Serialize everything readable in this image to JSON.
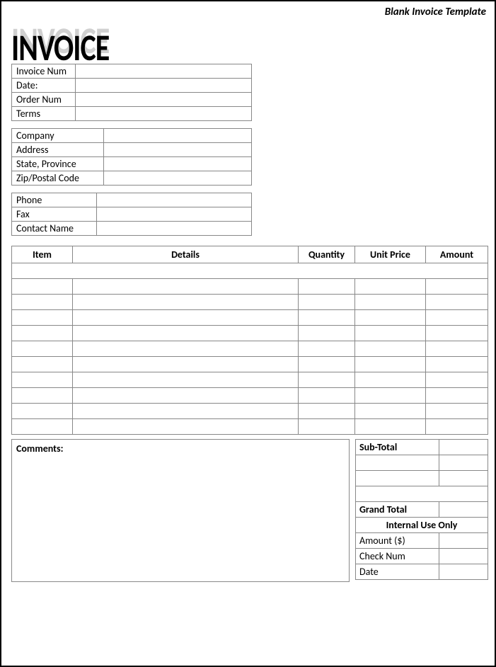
{
  "header": {
    "template_label": "Blank Invoice Template",
    "title": "INVOICE"
  },
  "info": {
    "rows": [
      {
        "label": "Invoice Num",
        "value": ""
      },
      {
        "label": "Date:",
        "value": ""
      },
      {
        "label": "Order Num",
        "value": ""
      },
      {
        "label": "Terms",
        "value": ""
      }
    ]
  },
  "company": {
    "rows": [
      {
        "label": "Company",
        "value": ""
      },
      {
        "label": "Address",
        "value": ""
      },
      {
        "label": "State, Province",
        "value": ""
      },
      {
        "label": "Zip/Postal Code",
        "value": ""
      }
    ]
  },
  "contact": {
    "rows": [
      {
        "label": "Phone",
        "value": ""
      },
      {
        "label": "Fax",
        "value": ""
      },
      {
        "label": "Contact Name",
        "value": ""
      }
    ]
  },
  "items": {
    "headers": [
      "Item",
      "Details",
      "Quantity",
      "Unit Price",
      "Amount"
    ],
    "rows": [
      [
        "",
        "",
        "",
        "",
        ""
      ],
      [
        "",
        "",
        "",
        "",
        ""
      ],
      [
        "",
        "",
        "",
        "",
        ""
      ],
      [
        "",
        "",
        "",
        "",
        ""
      ],
      [
        "",
        "",
        "",
        "",
        ""
      ],
      [
        "",
        "",
        "",
        "",
        ""
      ],
      [
        "",
        "",
        "",
        "",
        ""
      ],
      [
        "",
        "",
        "",
        "",
        ""
      ],
      [
        "",
        "",
        "",
        "",
        ""
      ],
      [
        "",
        "",
        "",
        "",
        ""
      ]
    ]
  },
  "comments_label": "Comments:",
  "totals": {
    "subtotal_label": "Sub-Total",
    "subtotal_value": "",
    "extras": [
      {
        "label": "",
        "value": ""
      },
      {
        "label": "",
        "value": ""
      }
    ],
    "grand_label": "Grand Total",
    "grand_value": "",
    "internal_label": "Internal Use Only",
    "internal_rows": [
      {
        "label": "Amount ($)",
        "value": ""
      },
      {
        "label": "Check Num",
        "value": ""
      },
      {
        "label": "Date",
        "value": ""
      }
    ]
  }
}
